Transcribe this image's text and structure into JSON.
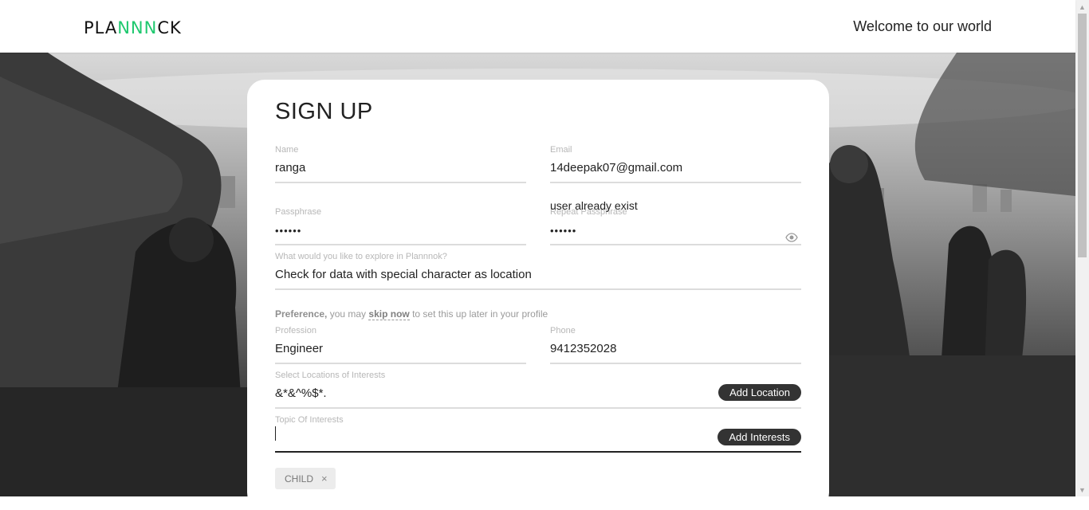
{
  "header": {
    "logo_pre": "PLA",
    "logo_accent": "NNN",
    "logo_post": "CK",
    "welcome": "Welcome to our world"
  },
  "form": {
    "title": "SIGN UP",
    "name": {
      "label": "Name",
      "value": "ranga"
    },
    "email": {
      "label": "Email",
      "value": "14deepak07@gmail.com"
    },
    "passphrase": {
      "label": "Passphrase",
      "value": "••••••"
    },
    "repeat_passphrase": {
      "label": "Repeat Passphrase",
      "value": "••••••"
    },
    "error": "user already exist",
    "explore": {
      "label": "What would you like to explore in Plannnok?",
      "value": "Check for data with special character as location"
    },
    "preference": {
      "bold": "Preference,",
      "text1": " you may ",
      "skip": "skip now",
      "text2": " to set this up later in your profile"
    },
    "profession": {
      "label": "Profession",
      "value": "Engineer"
    },
    "phone": {
      "label": "Phone",
      "value": "9412352028"
    },
    "locations": {
      "label": "Select Locations of Interests",
      "value": "&*&^%$*.",
      "button": "Add Location"
    },
    "topics": {
      "label": "Topic Of Interests",
      "value": "",
      "button": "Add Interests"
    },
    "chips": [
      {
        "label": "CHILD",
        "remove": "×"
      }
    ]
  },
  "colors": {
    "accent": "#1ec86e",
    "button_bg": "#333333",
    "chip_bg": "#ececec"
  }
}
